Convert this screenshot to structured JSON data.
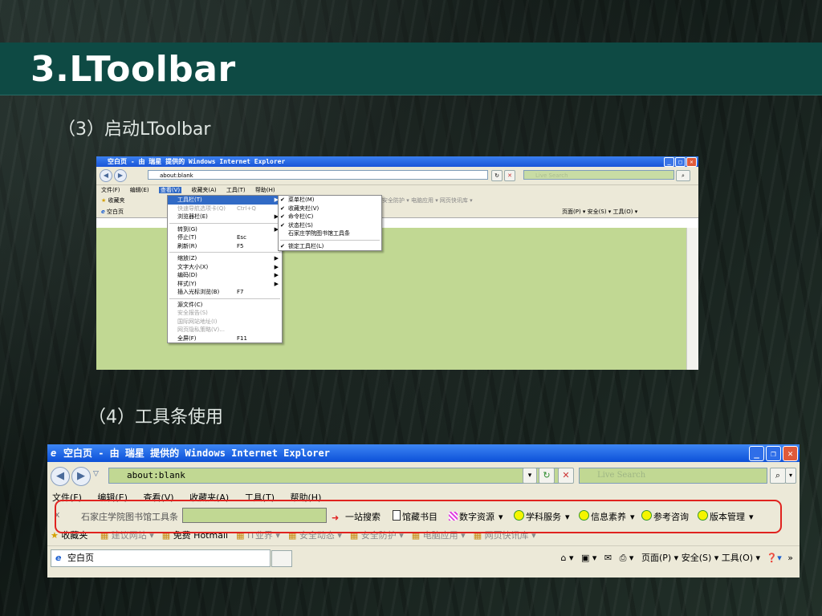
{
  "slide": {
    "title": "3.LToolbar",
    "caption1": "（3）启动LToolbar",
    "caption2": "（4）工具条使用"
  },
  "shot1": {
    "window_title": "空白页 - 由 瑞星 提供的 Windows Internet Explorer",
    "address": "about:blank",
    "search_placeholder": "Live Search",
    "menu": [
      "文件(F)",
      "编辑(E)",
      "查看(V)",
      "收藏夹(A)",
      "工具(T)",
      "帮助(H)"
    ],
    "favorites_label": "收藏夹",
    "fav_right": "安全防护 ▾  电脑应用 ▾  网页快讯库 ▾",
    "tab_label": "空白页",
    "cmd_right": "页面(P) ▾  安全(S) ▾  工具(O) ▾",
    "view_menu": {
      "g1": [
        {
          "label": "工具栏(T)",
          "shortcut": "",
          "arrow": "▶",
          "state": "hl"
        },
        {
          "label": "快速导航选项卡(Q)",
          "shortcut": "Ctrl+Q",
          "arrow": "",
          "state": "dis"
        },
        {
          "label": "浏览器栏(E)",
          "shortcut": "",
          "arrow": "▶",
          "state": ""
        }
      ],
      "g2": [
        {
          "label": "转到(G)",
          "shortcut": "",
          "arrow": "▶",
          "state": ""
        },
        {
          "label": "停止(T)",
          "shortcut": "Esc",
          "arrow": "",
          "state": ""
        },
        {
          "label": "刷新(R)",
          "shortcut": "F5",
          "arrow": "",
          "state": ""
        }
      ],
      "g3": [
        {
          "label": "缩放(Z)",
          "shortcut": "",
          "arrow": "▶",
          "state": ""
        },
        {
          "label": "文字大小(X)",
          "shortcut": "",
          "arrow": "▶",
          "state": ""
        },
        {
          "label": "编码(D)",
          "shortcut": "",
          "arrow": "▶",
          "state": ""
        },
        {
          "label": "样式(Y)",
          "shortcut": "",
          "arrow": "▶",
          "state": ""
        },
        {
          "label": "插入光标浏览(B)",
          "shortcut": "F7",
          "arrow": "",
          "state": ""
        }
      ],
      "g4": [
        {
          "label": "源文件(C)",
          "shortcut": "",
          "arrow": "",
          "state": ""
        },
        {
          "label": "安全报告(S)",
          "shortcut": "",
          "arrow": "",
          "state": "dis"
        },
        {
          "label": "国际网站地址(I)",
          "shortcut": "",
          "arrow": "",
          "state": "dis"
        },
        {
          "label": "网页隐私策略(V)...",
          "shortcut": "",
          "arrow": "",
          "state": "dis"
        },
        {
          "label": "全屏(F)",
          "shortcut": "F11",
          "arrow": "",
          "state": ""
        }
      ]
    },
    "toolbar_submenu": {
      "g1": [
        {
          "label": "菜单栏(M)",
          "check": "✔"
        },
        {
          "label": "收藏夹栏(V)",
          "check": "✔"
        },
        {
          "label": "命令栏(C)",
          "check": "✔"
        },
        {
          "label": "状态栏(S)",
          "check": "✔"
        },
        {
          "label": "石家庄学院图书馆工具条",
          "check": ""
        }
      ],
      "g2": [
        {
          "label": "锁定工具栏(L)",
          "check": "✔"
        }
      ]
    }
  },
  "shot2": {
    "window_title": "空白页 - 由 瑞星 提供的 Windows Internet Explorer",
    "address": "about:blank",
    "search_placeholder": "Live Search",
    "menu": [
      "文件(F)",
      "编辑(E)",
      "查看(V)",
      "收藏夹(A)",
      "工具(T)",
      "帮助(H)"
    ],
    "ltoolbar": {
      "close": "x",
      "label": "石家庄学院图书馆工具条",
      "search_value": "",
      "items": [
        {
          "label": "一站搜索",
          "icon": "arrow-icon",
          "color": "#ff9c00",
          "dropdown": ""
        },
        {
          "label": "馆藏书目",
          "icon": "book-icon",
          "color": "#ffffff",
          "dropdown": ""
        },
        {
          "label": "数字资源",
          "icon": "grid-icon",
          "color": "#e040e0",
          "dropdown": "▾"
        },
        {
          "label": "学科服务",
          "icon": "circle-icon",
          "color": "#f5f500",
          "dropdown": "▾"
        },
        {
          "label": "信息素养",
          "icon": "circle-icon",
          "color": "#f5f500",
          "dropdown": "▾"
        },
        {
          "label": "参考咨询",
          "icon": "circle-icon",
          "color": "#f5f500",
          "dropdown": ""
        },
        {
          "label": "版本管理",
          "icon": "circle-icon",
          "color": "#f5f500",
          "dropdown": "▾"
        }
      ]
    },
    "favorites": {
      "label": "收藏夹",
      "items": [
        {
          "label": "建议网站 ▾",
          "grey": true
        },
        {
          "label": "免费 Hotmail",
          "grey": false
        },
        {
          "label": "IT业界 ▾",
          "grey": true
        },
        {
          "label": "安全动态 ▾",
          "grey": true
        },
        {
          "label": "安全防护 ▾",
          "grey": true
        },
        {
          "label": "电脑应用 ▾",
          "grey": true
        },
        {
          "label": "网页快讯库 ▾",
          "grey": true
        }
      ]
    },
    "tab_label": "空白页",
    "commands": "页面(P) ▾  安全(S) ▾  工具(O) ▾",
    "colors": {
      "highlight_border": "#e0231f",
      "content_green": "#c1d893",
      "title_bar": "#0e4a44"
    }
  }
}
